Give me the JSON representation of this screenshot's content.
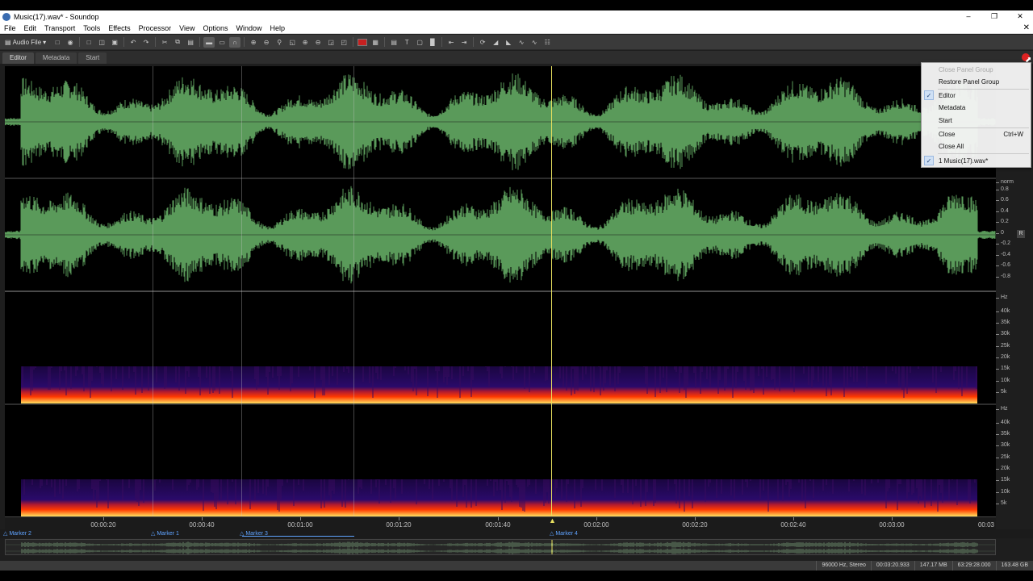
{
  "window": {
    "title": "Music(17).wav* - Soundop",
    "minimize": "‒",
    "restore": "❐",
    "close": "✕"
  },
  "menu": {
    "items": [
      "File",
      "Edit",
      "Transport",
      "Tools",
      "Effects",
      "Processor",
      "View",
      "Options",
      "Window",
      "Help"
    ],
    "close": "✕"
  },
  "toolbar": {
    "audio_file_label": "Audio File"
  },
  "tabs": [
    "Editor",
    "Metadata",
    "Start"
  ],
  "waveform_scale": {
    "unit": "norm",
    "ticks": [
      "0.8",
      "0.6",
      "0.4",
      "0.2",
      "0",
      "-0.2",
      "-0.4",
      "-0.6",
      "-0.8"
    ],
    "r_button": "R"
  },
  "spectrogram_scale": {
    "unit": "Hz",
    "ticks": [
      "40k",
      "35k",
      "30k",
      "25k",
      "20k",
      "15k",
      "10k",
      "5k"
    ]
  },
  "timeline": {
    "labels": [
      "00:00:20",
      "00:00:40",
      "00:01:00",
      "00:01:20",
      "00:01:40",
      "00:02:00",
      "00:02:20",
      "00:02:40",
      "00:03:00",
      "00:03"
    ]
  },
  "markers": [
    {
      "label": "Marker 2"
    },
    {
      "label": "Marker 1"
    },
    {
      "label": "Marker 3"
    },
    {
      "label": "Marker 4"
    }
  ],
  "context_menu": {
    "close_panel_group": "Close Panel Group",
    "restore_panel_group": "Restore Panel Group",
    "editor": "Editor",
    "metadata": "Metadata",
    "start": "Start",
    "close": "Close",
    "close_shortcut": "Ctrl+W",
    "close_all": "Close All",
    "recent_file": "1 Music(17).wav*"
  },
  "status": {
    "format": "96000 Hz, Stereo",
    "duration": "00:03:20.933",
    "size": "147.17 MB",
    "free_time": "63:29:28.000",
    "free_disk": "163.48 GB"
  },
  "colors": {
    "waveform": "#5a9a5a",
    "playhead": "#e8e060",
    "marker": "#5fa3ff"
  }
}
